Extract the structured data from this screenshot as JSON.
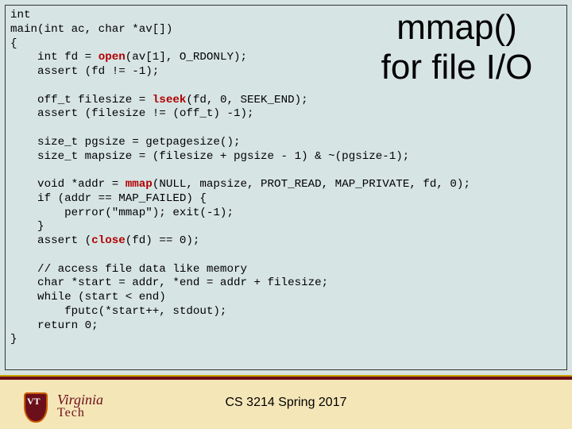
{
  "title": {
    "line1": "mmap()",
    "line2": "for file I/O"
  },
  "code": {
    "l0": "int",
    "l1": "main(int ac, char *av[])",
    "l2": "{",
    "l3a": "    int fd = ",
    "l3b": "open",
    "l3c": "(av[1], O_RDONLY);",
    "l4": "    assert (fd != -1);",
    "l5": "",
    "l6a": "    off_t filesize = ",
    "l6b": "lseek",
    "l6c": "(fd, 0, SEEK_END);",
    "l7": "    assert (filesize != (off_t) -1);",
    "l8": "",
    "l9": "    size_t pgsize = getpagesize();",
    "l10": "    size_t mapsize = (filesize + pgsize - 1) & ~(pgsize-1);",
    "l11": "",
    "l12a": "    void *addr = ",
    "l12b": "mmap",
    "l12c": "(NULL, mapsize, PROT_READ, MAP_PRIVATE, fd, 0);",
    "l13": "    if (addr == MAP_FAILED) {",
    "l14": "        perror(\"mmap\"); exit(-1);",
    "l15": "    }",
    "l16a": "    assert (",
    "l16b": "close",
    "l16c": "(fd) == 0);",
    "l17": "",
    "l18": "    // access file data like memory",
    "l19": "    char *start = addr, *end = addr + filesize;",
    "l20": "    while (start < end)",
    "l21": "        fputc(*start++, stdout);",
    "l22": "    return 0;",
    "l23": "}"
  },
  "footer": "CS 3214 Spring 2017",
  "logo": {
    "virginia": "Virginia",
    "tech": "Tech",
    "vt": "VT"
  }
}
